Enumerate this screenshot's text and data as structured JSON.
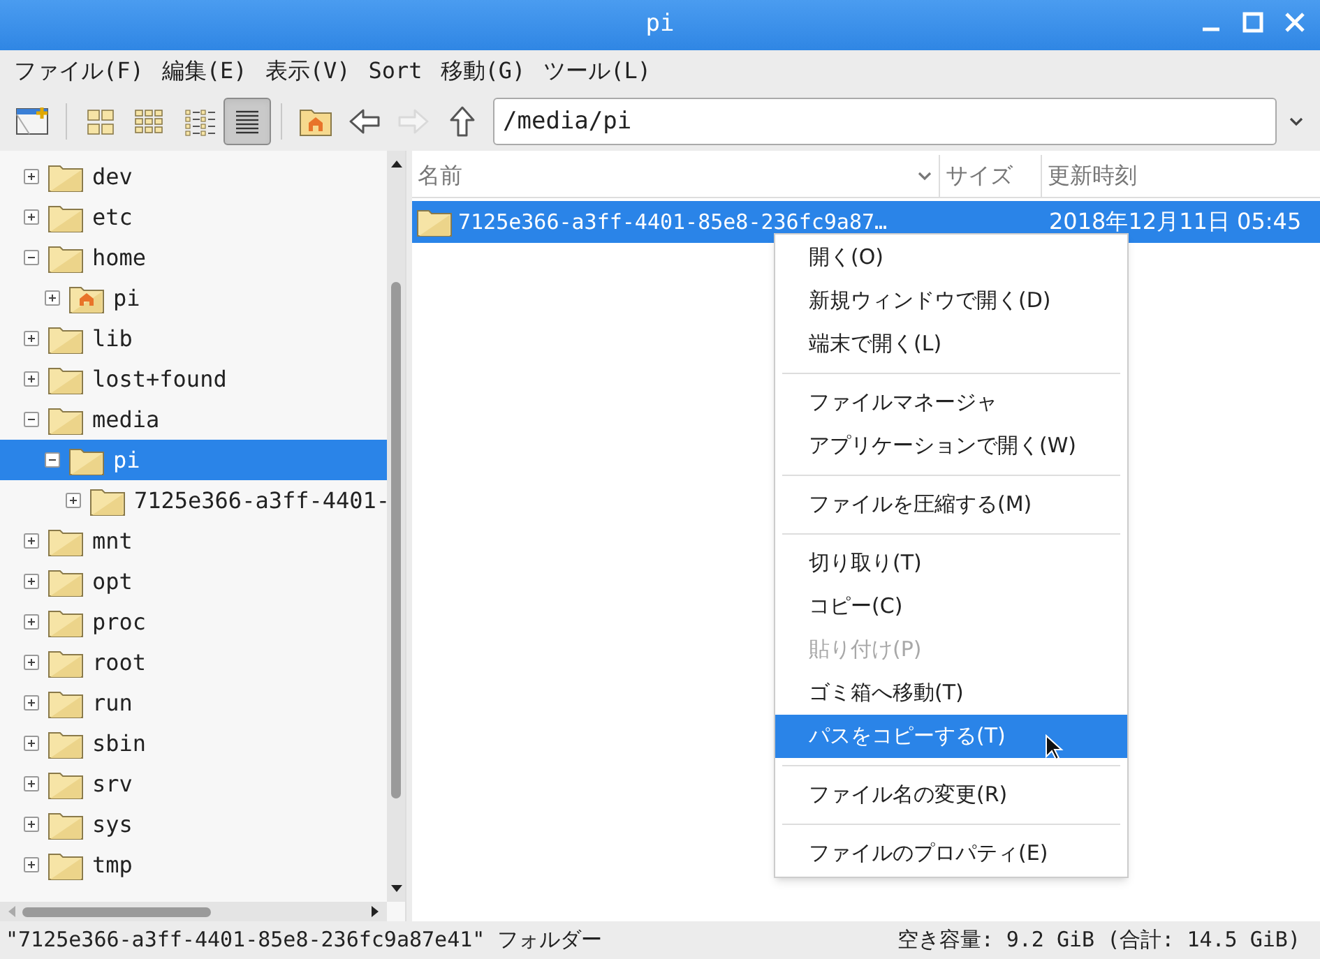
{
  "window": {
    "title": "pi"
  },
  "menubar": [
    "ファイル(F)",
    "編集(E)",
    "表示(V)",
    "Sort",
    "移動(G)",
    "ツール(L)"
  ],
  "toolbar": [
    {
      "kind": "new-window",
      "selected": false,
      "disabled": false
    },
    {
      "kind": "separator"
    },
    {
      "kind": "icon-view",
      "selected": false,
      "disabled": false
    },
    {
      "kind": "thumbnail-view",
      "selected": false,
      "disabled": false
    },
    {
      "kind": "compact-view",
      "selected": false,
      "disabled": false
    },
    {
      "kind": "detail-view",
      "selected": true,
      "disabled": false
    },
    {
      "kind": "separator"
    },
    {
      "kind": "home",
      "selected": false,
      "disabled": false
    },
    {
      "kind": "back",
      "selected": false,
      "disabled": false
    },
    {
      "kind": "forward",
      "selected": false,
      "disabled": true
    },
    {
      "kind": "up",
      "selected": false,
      "disabled": false
    }
  ],
  "path": {
    "value": "/media/pi"
  },
  "tree": [
    {
      "label": "dev",
      "expanded": false,
      "selected": false
    },
    {
      "label": "etc",
      "expanded": false,
      "selected": false
    },
    {
      "label": "home",
      "expanded": true,
      "selected": false,
      "children": [
        {
          "label": "pi",
          "kind": "home",
          "expanded": false,
          "selected": false
        }
      ]
    },
    {
      "label": "lib",
      "expanded": false,
      "selected": false
    },
    {
      "label": "lost+found",
      "expanded": false,
      "selected": false
    },
    {
      "label": "media",
      "expanded": true,
      "selected": false,
      "children": [
        {
          "label": "pi",
          "expanded": true,
          "selected": true,
          "children": [
            {
              "label": "7125e366-a3ff-4401-",
              "expanded": false,
              "selected": false
            }
          ]
        }
      ]
    },
    {
      "label": "mnt",
      "expanded": false,
      "selected": false
    },
    {
      "label": "opt",
      "expanded": false,
      "selected": false
    },
    {
      "label": "proc",
      "expanded": false,
      "selected": false
    },
    {
      "label": "root",
      "expanded": false,
      "selected": false
    },
    {
      "label": "run",
      "expanded": false,
      "selected": false
    },
    {
      "label": "sbin",
      "expanded": false,
      "selected": false
    },
    {
      "label": "srv",
      "expanded": false,
      "selected": false
    },
    {
      "label": "sys",
      "expanded": false,
      "selected": false
    },
    {
      "label": "tmp",
      "expanded": false,
      "selected": false
    }
  ],
  "table": {
    "columns": [
      {
        "label": "名前",
        "sorted": true
      },
      {
        "label": "サイズ",
        "sorted": false
      },
      {
        "label": "更新時刻",
        "sorted": false
      }
    ],
    "rows": [
      {
        "name": "7125e366-a3ff-4401-85e8-236fc9a87…",
        "size": "",
        "modified": "2018年12月11日 05:45",
        "selected": true
      }
    ]
  },
  "context_menu": [
    {
      "kind": "item",
      "label": "開く(O)",
      "disabled": false,
      "selected": false
    },
    {
      "kind": "item",
      "label": "新規ウィンドウで開く(D)",
      "disabled": false,
      "selected": false
    },
    {
      "kind": "item",
      "label": "端末で開く(L)",
      "disabled": false,
      "selected": false
    },
    {
      "kind": "separator"
    },
    {
      "kind": "item",
      "label": "ファイルマネージャ",
      "disabled": false,
      "selected": false
    },
    {
      "kind": "item",
      "label": "アプリケーションで開く(W)",
      "disabled": false,
      "selected": false
    },
    {
      "kind": "separator"
    },
    {
      "kind": "item",
      "label": "ファイルを圧縮する(M)",
      "disabled": false,
      "selected": false
    },
    {
      "kind": "separator"
    },
    {
      "kind": "item",
      "label": "切り取り(T)",
      "disabled": false,
      "selected": false
    },
    {
      "kind": "item",
      "label": "コピー(C)",
      "disabled": false,
      "selected": false
    },
    {
      "kind": "item",
      "label": "貼り付け(P)",
      "disabled": true,
      "selected": false
    },
    {
      "kind": "item",
      "label": "ゴミ箱へ移動(T)",
      "disabled": false,
      "selected": false
    },
    {
      "kind": "item",
      "label": "パスをコピーする(T)",
      "disabled": false,
      "selected": true
    },
    {
      "kind": "separator"
    },
    {
      "kind": "item",
      "label": "ファイル名の変更(R)",
      "disabled": false,
      "selected": false
    },
    {
      "kind": "separator"
    },
    {
      "kind": "item",
      "label": "ファイルのプロパティ(E)",
      "disabled": false,
      "selected": false
    }
  ],
  "status_bar": {
    "left": "\"7125e366-a3ff-4401-85e8-236fc9a87e41\" フォルダー",
    "right": "空き容量: 9.2 GiB (合計: 14.5 GiB)"
  }
}
